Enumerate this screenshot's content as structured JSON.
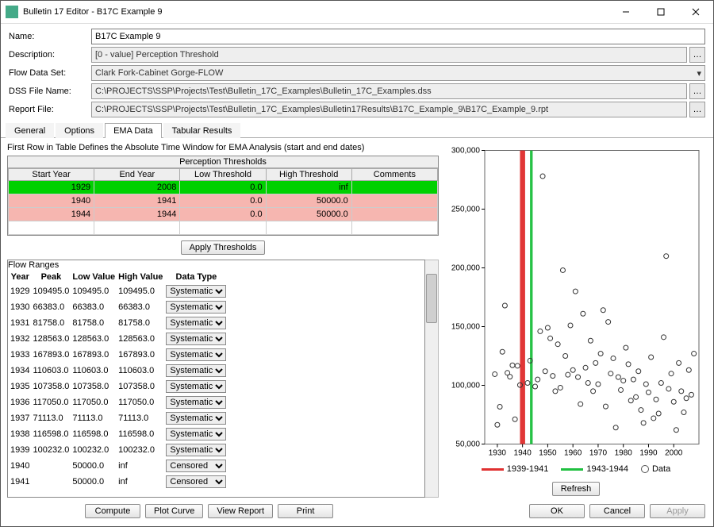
{
  "title": "Bulletin 17 Editor - B17C Example 9",
  "labels": {
    "name": "Name:",
    "description": "Description:",
    "flowDataSet": "Flow Data Set:",
    "dssFileName": "DSS File Name:",
    "reportFile": "Report File:"
  },
  "fields": {
    "name": "B17C Example 9",
    "description": "[0 - value] Perception Threshold",
    "flowDataSet": "Clark Fork-Cabinet Gorge-FLOW",
    "dssFileName": "C:\\PROJECTS\\SSP\\Projects\\Test\\Bulletin_17C_Examples\\Bulletin_17C_Examples.dss",
    "reportFile": "C:\\PROJECTS\\SSP\\Projects\\Test\\Bulletin_17C_Examples\\Bulletin17Results\\B17C_Example_9\\B17C_Example_9.rpt"
  },
  "tabs": [
    "General",
    "Options",
    "EMA Data",
    "Tabular Results"
  ],
  "activeTab": 2,
  "caption": "First Row in Table Defines the Absolute Time Window for EMA Analysis (start and end dates)",
  "pt": {
    "header": "Perception Thresholds",
    "cols": [
      "Start Year",
      "End Year",
      "Low Threshold",
      "High Threshold",
      "Comments"
    ],
    "rows": [
      {
        "sy": "1929",
        "ey": "2008",
        "lo": "0.0",
        "hi": "inf",
        "c": "",
        "cls": "green"
      },
      {
        "sy": "1940",
        "ey": "1941",
        "lo": "0.0",
        "hi": "50000.0",
        "c": "",
        "cls": "pink"
      },
      {
        "sy": "1944",
        "ey": "1944",
        "lo": "0.0",
        "hi": "50000.0",
        "c": "",
        "cls": "pink"
      },
      {
        "sy": "",
        "ey": "",
        "lo": "",
        "hi": "",
        "c": "",
        "cls": ""
      }
    ]
  },
  "applyThresholds": "Apply Thresholds",
  "flow": {
    "header": "Flow Ranges",
    "cols": [
      "Year",
      "Peak",
      "Low Value",
      "High Value",
      "Data Type"
    ],
    "rows": [
      {
        "y": "1929",
        "p": "109495.0",
        "lo": "109495.0",
        "hi": "109495.0",
        "dt": "Systematic"
      },
      {
        "y": "1930",
        "p": "66383.0",
        "lo": "66383.0",
        "hi": "66383.0",
        "dt": "Systematic"
      },
      {
        "y": "1931",
        "p": "81758.0",
        "lo": "81758.0",
        "hi": "81758.0",
        "dt": "Systematic"
      },
      {
        "y": "1932",
        "p": "128563.0",
        "lo": "128563.0",
        "hi": "128563.0",
        "dt": "Systematic"
      },
      {
        "y": "1933",
        "p": "167893.0",
        "lo": "167893.0",
        "hi": "167893.0",
        "dt": "Systematic"
      },
      {
        "y": "1934",
        "p": "110603.0",
        "lo": "110603.0",
        "hi": "110603.0",
        "dt": "Systematic"
      },
      {
        "y": "1935",
        "p": "107358.0",
        "lo": "107358.0",
        "hi": "107358.0",
        "dt": "Systematic"
      },
      {
        "y": "1936",
        "p": "117050.0",
        "lo": "117050.0",
        "hi": "117050.0",
        "dt": "Systematic"
      },
      {
        "y": "1937",
        "p": "71113.0",
        "lo": "71113.0",
        "hi": "71113.0",
        "dt": "Systematic"
      },
      {
        "y": "1938",
        "p": "116598.0",
        "lo": "116598.0",
        "hi": "116598.0",
        "dt": "Systematic"
      },
      {
        "y": "1939",
        "p": "100232.0",
        "lo": "100232.0",
        "hi": "100232.0",
        "dt": "Systematic"
      },
      {
        "y": "1940",
        "p": "",
        "lo": "50000.0",
        "hi": "inf",
        "dt": "Censored"
      },
      {
        "y": "1941",
        "p": "",
        "lo": "50000.0",
        "hi": "inf",
        "dt": "Censored"
      }
    ]
  },
  "buttons": {
    "compute": "Compute",
    "plotCurve": "Plot Curve",
    "viewReport": "View Report",
    "print": "Print",
    "refresh": "Refresh",
    "ok": "OK",
    "cancel": "Cancel",
    "apply": "Apply"
  },
  "chart_data": {
    "type": "scatter",
    "title": "",
    "xlabel": "",
    "ylabel": "",
    "xlim": [
      1925,
      2010
    ],
    "ylim": [
      50000,
      300000
    ],
    "yticks": [
      50000,
      100000,
      150000,
      200000,
      250000,
      300000
    ],
    "yticklabels": [
      "50,000",
      "100,000",
      "150,000",
      "200,000",
      "250,000",
      "300,000"
    ],
    "xticks": [
      1930,
      1940,
      1950,
      1960,
      1970,
      1980,
      1990,
      2000
    ],
    "series": [
      {
        "name": "1939-1941",
        "type": "vband",
        "x0": 1939,
        "x1": 1941,
        "color": "#e03030"
      },
      {
        "name": "1943-1944",
        "type": "vband",
        "x0": 1943,
        "x1": 1944,
        "color": "#20c040"
      },
      {
        "name": "Data",
        "type": "scatter",
        "color": "#333",
        "points": [
          [
            1929,
            109495
          ],
          [
            1930,
            66383
          ],
          [
            1931,
            81758
          ],
          [
            1932,
            128563
          ],
          [
            1933,
            167893
          ],
          [
            1934,
            110603
          ],
          [
            1935,
            107358
          ],
          [
            1936,
            117050
          ],
          [
            1937,
            71113
          ],
          [
            1938,
            116598
          ],
          [
            1939,
            100232
          ],
          [
            1942,
            102000
          ],
          [
            1943,
            121000
          ],
          [
            1945,
            99000
          ],
          [
            1946,
            105000
          ],
          [
            1947,
            146000
          ],
          [
            1948,
            278000
          ],
          [
            1949,
            112000
          ],
          [
            1950,
            149000
          ],
          [
            1951,
            140000
          ],
          [
            1952,
            108000
          ],
          [
            1953,
            95000
          ],
          [
            1954,
            135000
          ],
          [
            1955,
            98000
          ],
          [
            1956,
            198000
          ],
          [
            1957,
            125000
          ],
          [
            1958,
            109000
          ],
          [
            1959,
            151000
          ],
          [
            1960,
            113000
          ],
          [
            1961,
            180000
          ],
          [
            1962,
            107000
          ],
          [
            1963,
            84000
          ],
          [
            1964,
            161000
          ],
          [
            1965,
            115000
          ],
          [
            1966,
            102000
          ],
          [
            1967,
            138000
          ],
          [
            1968,
            95000
          ],
          [
            1969,
            119000
          ],
          [
            1970,
            101000
          ],
          [
            1971,
            127000
          ],
          [
            1972,
            164000
          ],
          [
            1973,
            82000
          ],
          [
            1974,
            154000
          ],
          [
            1975,
            110000
          ],
          [
            1976,
            123000
          ],
          [
            1977,
            64000
          ],
          [
            1978,
            107000
          ],
          [
            1979,
            96000
          ],
          [
            1980,
            104000
          ],
          [
            1981,
            132000
          ],
          [
            1982,
            118000
          ],
          [
            1983,
            87000
          ],
          [
            1984,
            105000
          ],
          [
            1985,
            90000
          ],
          [
            1986,
            112000
          ],
          [
            1987,
            79000
          ],
          [
            1988,
            68000
          ],
          [
            1989,
            101000
          ],
          [
            1990,
            94000
          ],
          [
            1991,
            124000
          ],
          [
            1992,
            72000
          ],
          [
            1993,
            88000
          ],
          [
            1994,
            76000
          ],
          [
            1995,
            102000
          ],
          [
            1996,
            141000
          ],
          [
            1997,
            210000
          ],
          [
            1998,
            97000
          ],
          [
            1999,
            110000
          ],
          [
            2000,
            86000
          ],
          [
            2001,
            62000
          ],
          [
            2002,
            119000
          ],
          [
            2003,
            95000
          ],
          [
            2004,
            77000
          ],
          [
            2005,
            89000
          ],
          [
            2006,
            113000
          ],
          [
            2007,
            92000
          ],
          [
            2008,
            127000
          ]
        ]
      }
    ],
    "legend": [
      "1939-1941",
      "1943-1944",
      "Data"
    ]
  }
}
